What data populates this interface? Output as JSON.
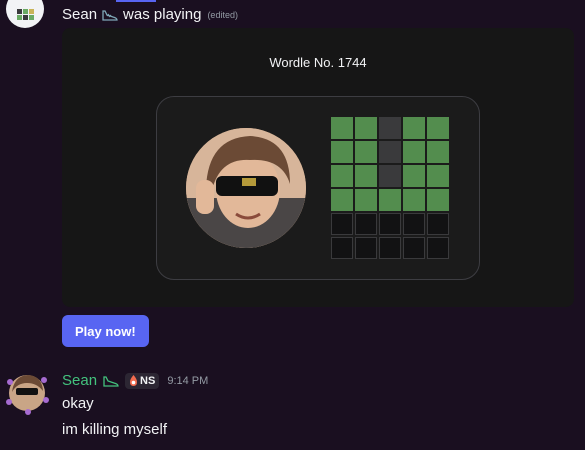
{
  "post": {
    "author": "Sean",
    "verb": "was playing",
    "edited": "(edited)"
  },
  "embed": {
    "title": "Wordle No. 1744",
    "board": [
      [
        "correct",
        "correct",
        "absent",
        "correct",
        "correct"
      ],
      [
        "correct",
        "correct",
        "absent",
        "correct",
        "correct"
      ],
      [
        "correct",
        "correct",
        "absent",
        "correct",
        "correct"
      ],
      [
        "correct",
        "correct",
        "correct",
        "correct",
        "correct"
      ],
      [
        "empty",
        "empty",
        "empty",
        "empty",
        "empty"
      ],
      [
        "empty",
        "empty",
        "empty",
        "empty",
        "empty"
      ]
    ]
  },
  "play_button": {
    "label": "Play now!"
  },
  "message": {
    "author": "Sean",
    "tag": "NS",
    "timestamp": "9:14 PM",
    "lines": [
      "okay",
      "im killing myself"
    ]
  },
  "colors": {
    "background": "#1a0f20",
    "embed": "#161616",
    "correct": "#538d4e",
    "absent": "#3a3a3c",
    "button": "#5865f2",
    "author_name": "#43c27d"
  },
  "icons": {
    "app": "wordle-app-icon",
    "shoe": "shoe-icon",
    "fire": "fire-icon"
  }
}
